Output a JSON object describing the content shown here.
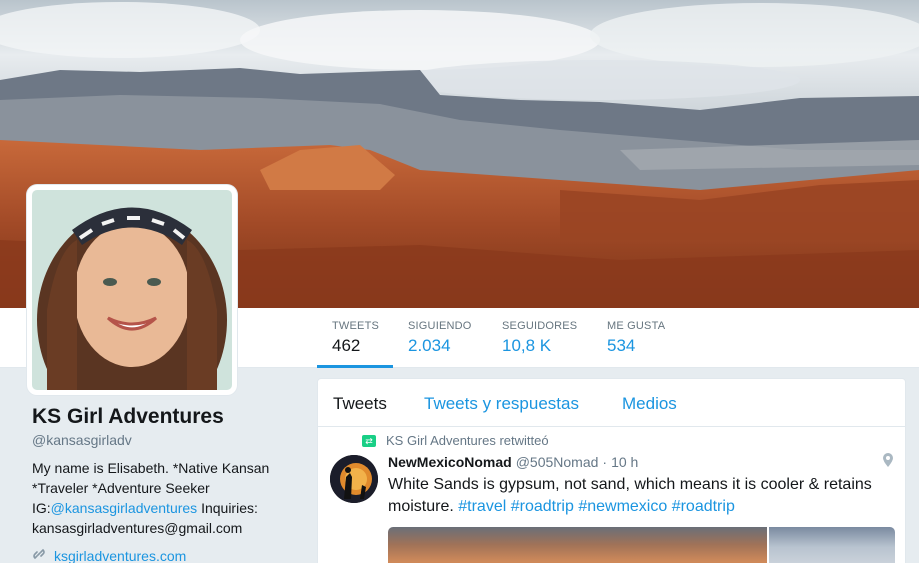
{
  "profile": {
    "name": "KS Girl Adventures",
    "handle": "@kansasgirladv",
    "bio_text_1": "My name is Elisabeth. *Native Kansan *Traveler *Adventure Seeker IG:",
    "bio_link": "@kansasgirladventures",
    "bio_text_2": " Inquiries: kansasgirladventures@gmail.com",
    "website": "ksgirladventures.com"
  },
  "stats": [
    {
      "label": "TWEETS",
      "value": "462"
    },
    {
      "label": "SIGUIENDO",
      "value": "2.034"
    },
    {
      "label": "SEGUIDORES",
      "value": "10,8 K"
    },
    {
      "label": "ME GUSTA",
      "value": "534"
    }
  ],
  "tabs": [
    "Tweets",
    "Tweets y respuestas",
    "Medios"
  ],
  "tweet": {
    "retweet_label": "KS Girl Adventures retwitteó",
    "author_name": "NewMexicoNomad",
    "author_handle": "@505Nomad",
    "time": "10 h",
    "text": "White Sands is gypsum, not sand, which means it is cooler & retains moisture.",
    "hashtags": "#travel #roadtrip #newmexico #roadtrip"
  },
  "icons": {
    "retweet": "retweet-icon",
    "location": "location-pin-icon",
    "link": "link-icon"
  },
  "colors": {
    "accent": "#1b95e0",
    "retweet": "#19cf86",
    "text": "#14171a",
    "muted": "#657786"
  }
}
